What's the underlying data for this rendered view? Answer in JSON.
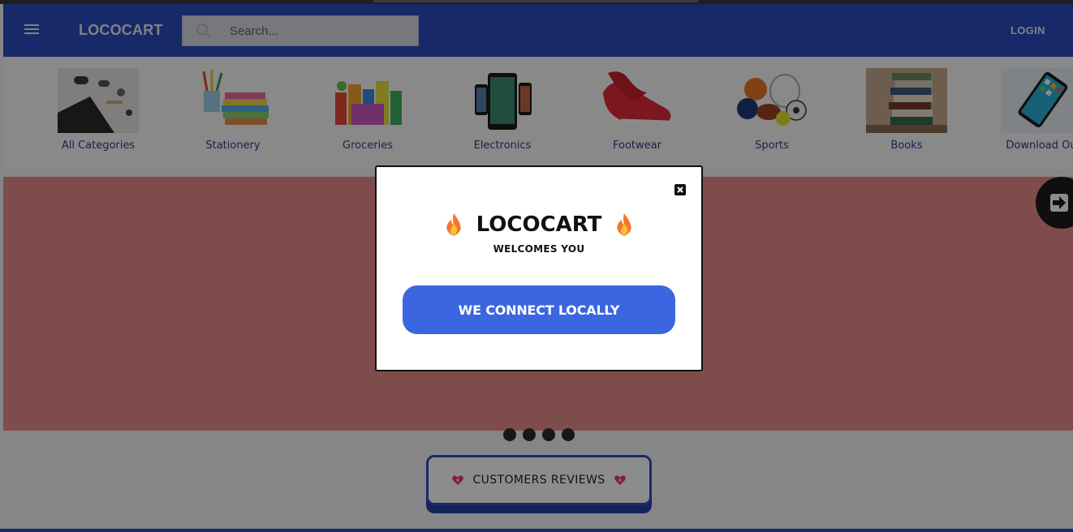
{
  "header": {
    "brand": "LOCOCART",
    "search_placeholder": "Search...",
    "login_label": "LOGIN",
    "color": "#2b4bbd"
  },
  "categories": [
    {
      "label": "All Categories",
      "icon": "all-categories-image"
    },
    {
      "label": "Stationery",
      "icon": "stationery-image"
    },
    {
      "label": "Groceries",
      "icon": "groceries-image"
    },
    {
      "label": "Electronics",
      "icon": "electronics-image"
    },
    {
      "label": "Footwear",
      "icon": "footwear-image"
    },
    {
      "label": "Sports",
      "icon": "sports-image"
    },
    {
      "label": "Books",
      "icon": "books-image"
    },
    {
      "label": "Download Ou",
      "icon": "download-app-image"
    }
  ],
  "slider": {
    "dot_count": 4,
    "banner_color": "#e88b8b"
  },
  "reviews": {
    "label": "CUSTOMERS REVIEWS",
    "icon": "heart-icon"
  },
  "modal": {
    "title": "LOCOCART",
    "subtitle": "WELCOMES YOU",
    "button_label": "WE CONNECT LOCALLY",
    "title_icon": "fire-icon",
    "button_color": "#3b66e0"
  }
}
